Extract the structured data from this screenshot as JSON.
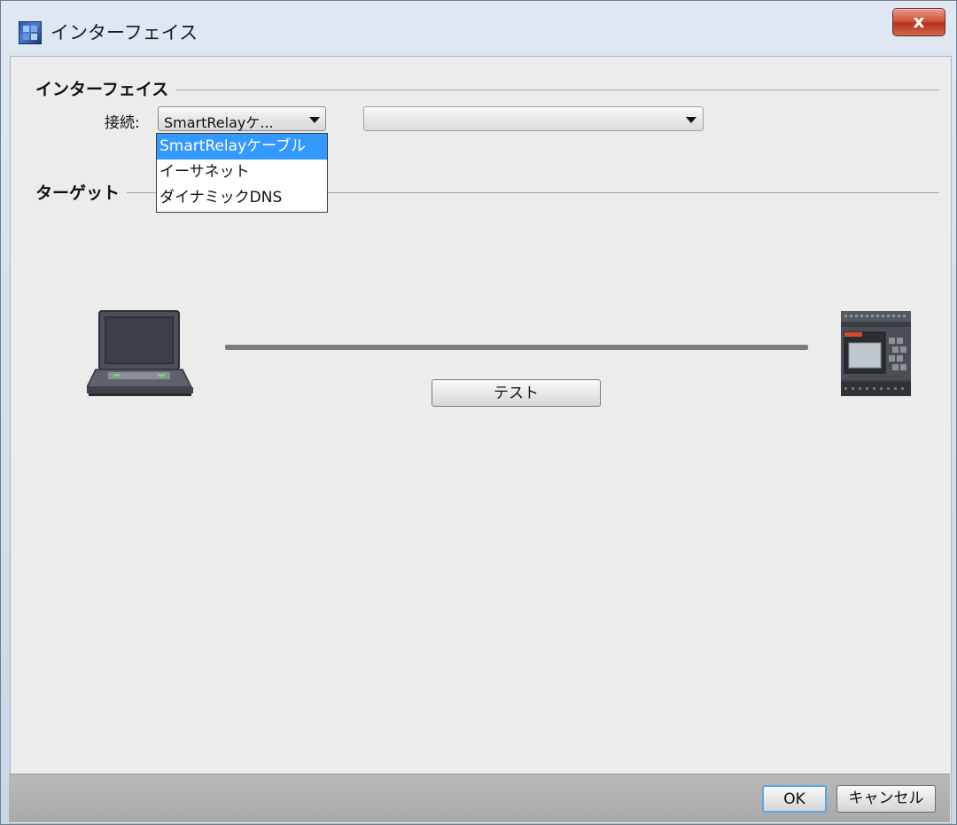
{
  "window": {
    "title": "インターフェイス",
    "close_label": "x"
  },
  "interface_group": {
    "title": "インターフェイス",
    "connection_label": "接続:",
    "connection_value": "SmartRelayケ...",
    "secondary_value": ""
  },
  "dropdown": {
    "options": [
      "SmartRelayケーブル",
      "イーサネット",
      "ダイナミックDNS"
    ],
    "selected_index": 0
  },
  "target_group": {
    "title": "ターゲット"
  },
  "diagram": {
    "left_device": "laptop-icon",
    "right_device": "plc-device-icon",
    "test_button": "テスト"
  },
  "footer": {
    "ok_label": "OK",
    "cancel_label": "キャンセル"
  },
  "colors": {
    "selection": "#3399ff",
    "close_button": "#c9452e",
    "default_button_border": "#57a6e6"
  }
}
